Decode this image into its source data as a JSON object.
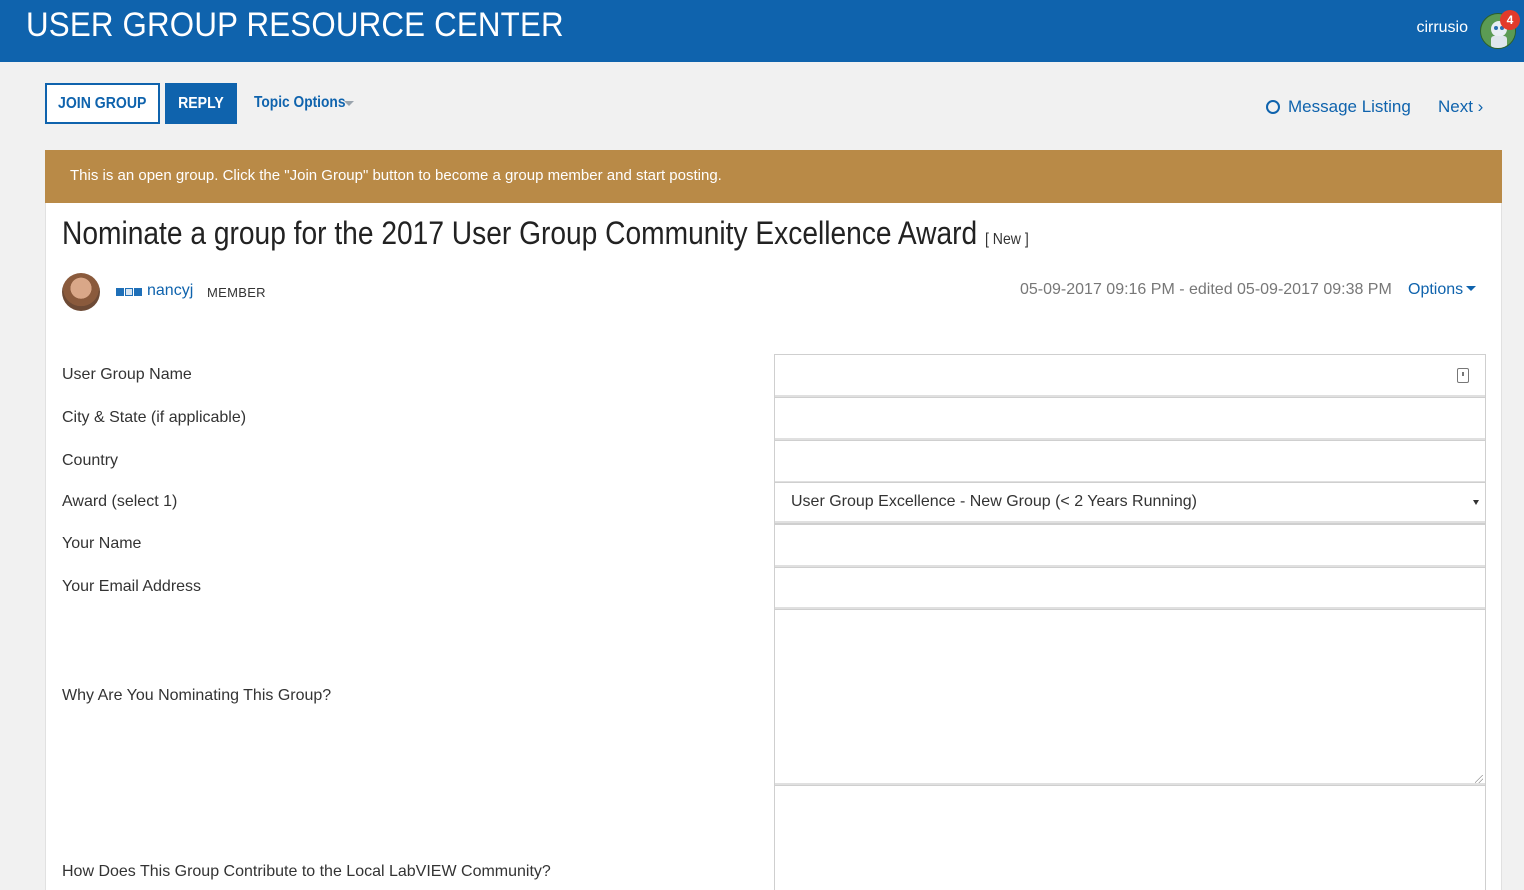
{
  "header": {
    "site_title": "USER GROUP RESOURCE CENTER",
    "username": "cirrusio",
    "notification_count": "4"
  },
  "actions": {
    "join_label": "JOIN GROUP",
    "reply_label": "REPLY",
    "topic_options_label": "Topic Options",
    "message_listing_label": "Message Listing",
    "next_label": "Next ›"
  },
  "banner": {
    "text": "This is an open group. Click the \"Join Group\" button to become a group member and start posting.",
    "color": "#b98a47"
  },
  "post": {
    "title": "Nominate a group for the 2017 User Group Community Excellence Award",
    "new_tag": "[ New ]",
    "author": "nancyj",
    "role": "MEMBER",
    "date": "05-09-2017 09:16 PM - edited 05-09-2017 09:38 PM",
    "options_label": "Options"
  },
  "form": {
    "fields": [
      {
        "label": "User Group Name",
        "value": ""
      },
      {
        "label": "City & State (if applicable)",
        "value": ""
      },
      {
        "label": "Country",
        "value": ""
      },
      {
        "label": "Award (select 1)",
        "value": "User Group Excellence - New Group (< 2 Years Running)"
      },
      {
        "label": "Your Name",
        "value": ""
      },
      {
        "label": "Your Email Address",
        "value": ""
      },
      {
        "label": "Why Are You Nominating This Group?",
        "value": ""
      },
      {
        "label": "How Does This Group Contribute to the Local LabVIEW Community?",
        "value": ""
      }
    ]
  },
  "colors": {
    "brand_blue": "#0f63ad",
    "background": "#f1f1f1"
  }
}
